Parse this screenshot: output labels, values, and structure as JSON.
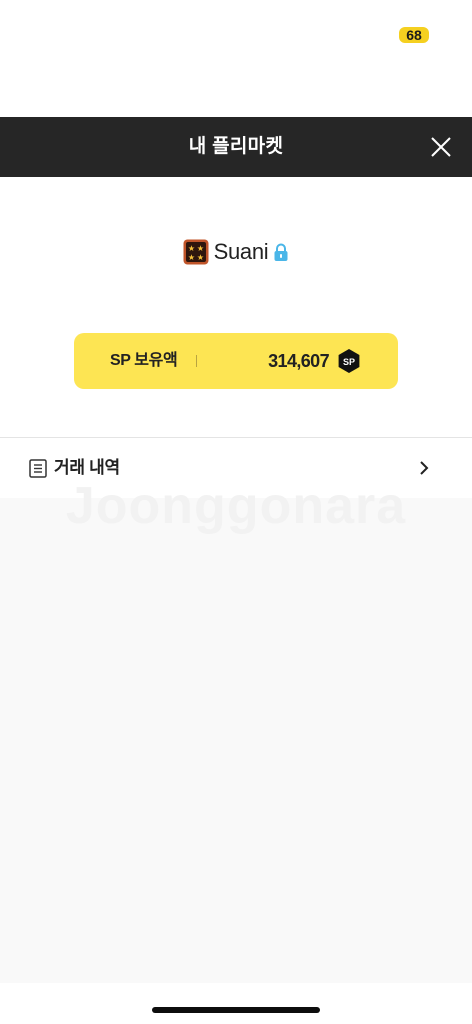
{
  "status_bar": {
    "battery_level": "68"
  },
  "header": {
    "title": "내 플리마켓"
  },
  "profile": {
    "username": "Suani"
  },
  "sp_card": {
    "label": "SP 보유액",
    "amount": "314,607",
    "coin_label": "SP"
  },
  "menu": {
    "history_label": "거래 내역"
  },
  "watermark": {
    "text": "Joonggonara"
  },
  "colors": {
    "header_bg": "#262626",
    "accent_yellow": "#fde553",
    "lock_blue": "#4ab6e8",
    "badge_yellow": "#f5d020"
  },
  "icons": {
    "close": "close-icon",
    "rank": "rank-badge-icon",
    "lock": "lock-icon",
    "coin": "sp-coin-icon",
    "document": "document-icon",
    "chevron": "chevron-right-icon"
  }
}
